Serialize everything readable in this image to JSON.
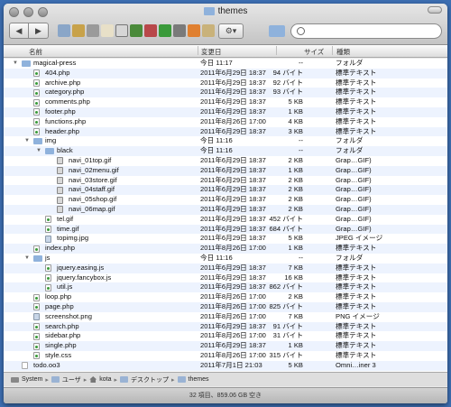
{
  "window": {
    "title": "themes"
  },
  "toolbar": {
    "back": "◀",
    "forward": "▶",
    "action": "⚙▾",
    "search_placeholder": "",
    "search_value": ""
  },
  "columns": {
    "name": "名前",
    "date": "変更日",
    "size": "サイズ",
    "kind": "種類"
  },
  "rows": [
    {
      "depth": 0,
      "disclosure": "▼",
      "icon": "folder",
      "name": "magical-press",
      "date": "今日 11:17",
      "size": "--",
      "kind": "フォルダ"
    },
    {
      "depth": 1,
      "disclosure": "",
      "icon": "php",
      "name": "404.php",
      "date": "2011年6月29日 18:37",
      "size": "94 バイト",
      "kind": "標準テキスト"
    },
    {
      "depth": 1,
      "disclosure": "",
      "icon": "php",
      "name": "archive.php",
      "date": "2011年6月29日 18:37",
      "size": "92 バイト",
      "kind": "標準テキスト"
    },
    {
      "depth": 1,
      "disclosure": "",
      "icon": "php",
      "name": "category.php",
      "date": "2011年6月29日 18:37",
      "size": "93 バイト",
      "kind": "標準テキスト"
    },
    {
      "depth": 1,
      "disclosure": "",
      "icon": "php",
      "name": "comments.php",
      "date": "2011年6月29日 18:37",
      "size": "5 KB",
      "kind": "標準テキスト"
    },
    {
      "depth": 1,
      "disclosure": "",
      "icon": "php",
      "name": "footer.php",
      "date": "2011年6月29日 18:37",
      "size": "1 KB",
      "kind": "標準テキスト"
    },
    {
      "depth": 1,
      "disclosure": "",
      "icon": "php",
      "name": "functions.php",
      "date": "2011年8月26日 17:00",
      "size": "4 KB",
      "kind": "標準テキスト"
    },
    {
      "depth": 1,
      "disclosure": "",
      "icon": "php",
      "name": "header.php",
      "date": "2011年6月29日 18:37",
      "size": "3 KB",
      "kind": "標準テキスト"
    },
    {
      "depth": 1,
      "disclosure": "▼",
      "icon": "folder",
      "name": "img",
      "date": "今日 11:16",
      "size": "--",
      "kind": "フォルダ"
    },
    {
      "depth": 2,
      "disclosure": "▼",
      "icon": "folder",
      "name": "black",
      "date": "今日 11:16",
      "size": "--",
      "kind": "フォルダ"
    },
    {
      "depth": 3,
      "disclosure": "",
      "icon": "gif",
      "name": "navi_01top.gif",
      "date": "2011年6月29日 18:37",
      "size": "2 KB",
      "kind": "Grap…GIF)"
    },
    {
      "depth": 3,
      "disclosure": "",
      "icon": "gif",
      "name": "navi_02menu.gif",
      "date": "2011年6月29日 18:37",
      "size": "1 KB",
      "kind": "Grap…GIF)"
    },
    {
      "depth": 3,
      "disclosure": "",
      "icon": "gif",
      "name": "navi_03store.gif",
      "date": "2011年6月29日 18:37",
      "size": "2 KB",
      "kind": "Grap…GIF)"
    },
    {
      "depth": 3,
      "disclosure": "",
      "icon": "gif",
      "name": "navi_04staff.gif",
      "date": "2011年6月29日 18:37",
      "size": "2 KB",
      "kind": "Grap…GIF)"
    },
    {
      "depth": 3,
      "disclosure": "",
      "icon": "gif",
      "name": "navi_05shop.gif",
      "date": "2011年6月29日 18:37",
      "size": "2 KB",
      "kind": "Grap…GIF)"
    },
    {
      "depth": 3,
      "disclosure": "",
      "icon": "gif",
      "name": "navi_06map.gif",
      "date": "2011年6月29日 18:37",
      "size": "2 KB",
      "kind": "Grap…GIF)"
    },
    {
      "depth": 2,
      "disclosure": "",
      "icon": "php",
      "name": "tel.gif",
      "date": "2011年6月29日 18:37",
      "size": "452 バイト",
      "kind": "Grap…GIF)"
    },
    {
      "depth": 2,
      "disclosure": "",
      "icon": "php",
      "name": "time.gif",
      "date": "2011年6月29日 18:37",
      "size": "684 バイト",
      "kind": "Grap…GIF)"
    },
    {
      "depth": 2,
      "disclosure": "",
      "icon": "img",
      "name": "topimg.jpg",
      "date": "2011年6月29日 18:37",
      "size": "5 KB",
      "kind": "JPEG イメージ"
    },
    {
      "depth": 1,
      "disclosure": "",
      "icon": "php",
      "name": "index.php",
      "date": "2011年8月26日 17:00",
      "size": "1 KB",
      "kind": "標準テキスト"
    },
    {
      "depth": 1,
      "disclosure": "▼",
      "icon": "folder",
      "name": "js",
      "date": "今日 11:16",
      "size": "--",
      "kind": "フォルダ"
    },
    {
      "depth": 2,
      "disclosure": "",
      "icon": "php",
      "name": "jquery.easing.js",
      "date": "2011年6月29日 18:37",
      "size": "7 KB",
      "kind": "標準テキスト"
    },
    {
      "depth": 2,
      "disclosure": "",
      "icon": "php",
      "name": "jquery.fancybox.js",
      "date": "2011年6月29日 18:37",
      "size": "16 KB",
      "kind": "標準テキスト"
    },
    {
      "depth": 2,
      "disclosure": "",
      "icon": "php",
      "name": "util.js",
      "date": "2011年6月29日 18:37",
      "size": "862 バイト",
      "kind": "標準テキスト"
    },
    {
      "depth": 1,
      "disclosure": "",
      "icon": "php",
      "name": "loop.php",
      "date": "2011年8月26日 17:00",
      "size": "2 KB",
      "kind": "標準テキスト"
    },
    {
      "depth": 1,
      "disclosure": "",
      "icon": "php",
      "name": "page.php",
      "date": "2011年8月26日 17:00",
      "size": "825 バイト",
      "kind": "標準テキスト"
    },
    {
      "depth": 1,
      "disclosure": "",
      "icon": "img",
      "name": "screenshot.png",
      "date": "2011年8月26日 17:00",
      "size": "7 KB",
      "kind": "PNG イメージ"
    },
    {
      "depth": 1,
      "disclosure": "",
      "icon": "php",
      "name": "search.php",
      "date": "2011年6月29日 18:37",
      "size": "91 バイト",
      "kind": "標準テキスト"
    },
    {
      "depth": 1,
      "disclosure": "",
      "icon": "php",
      "name": "sidebar.php",
      "date": "2011年8月26日 17:00",
      "size": "31 バイト",
      "kind": "標準テキスト"
    },
    {
      "depth": 1,
      "disclosure": "",
      "icon": "php",
      "name": "single.php",
      "date": "2011年6月29日 18:37",
      "size": "1 KB",
      "kind": "標準テキスト"
    },
    {
      "depth": 1,
      "disclosure": "",
      "icon": "php",
      "name": "style.css",
      "date": "2011年8月26日 17:00",
      "size": "315 バイト",
      "kind": "標準テキスト"
    },
    {
      "depth": 0,
      "disclosure": "",
      "icon": "doc",
      "name": "todo.oo3",
      "date": "2011年7月1日 21:03",
      "size": "5 KB",
      "kind": "Omni…iner 3"
    }
  ],
  "pathbar": [
    "System",
    "ユーザ",
    "kota",
    "デスクトップ",
    "themes"
  ],
  "status": "32 項目、859.06 GB 空き"
}
